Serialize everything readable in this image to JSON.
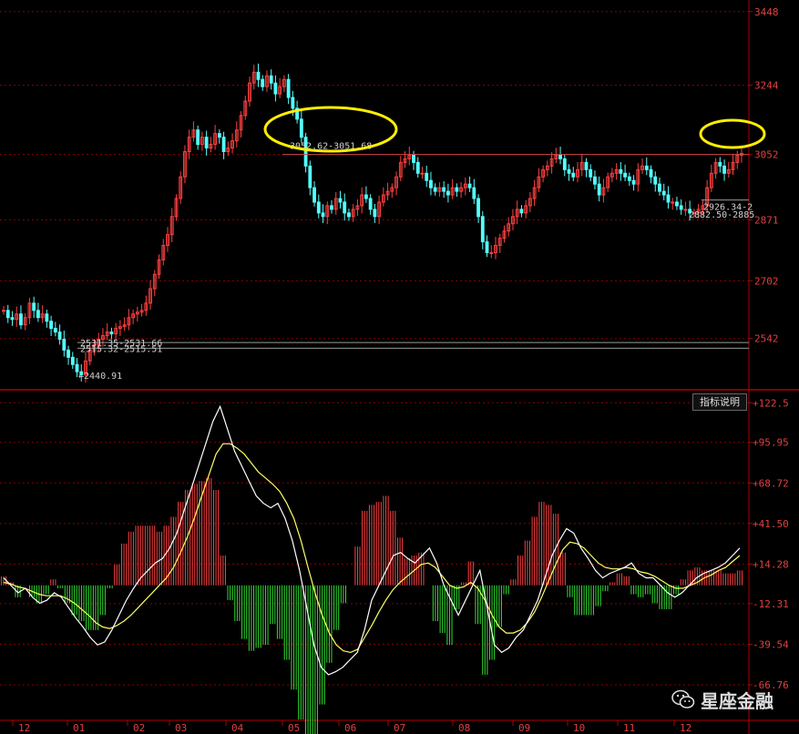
{
  "indicator_button_label": "指标说明",
  "watermark_text": "星座金融",
  "colors": {
    "up": "#ff4040",
    "down": "#54ffff",
    "macd_pos": "#ff4040",
    "macd_neg": "#33dd33",
    "dif": "#ffffff",
    "dea": "#ffff66",
    "grid": "#8b0000",
    "highlight": "#ffee00"
  },
  "chart_data": [
    {
      "type": "candlestick",
      "title": "",
      "y_ticks": [
        "3448",
        "3244",
        "3052",
        "2871",
        "2702",
        "2542"
      ],
      "ylim": [
        2400,
        3460
      ],
      "x_ticks": [
        "12",
        "01",
        "02",
        "03",
        "04",
        "05",
        "06",
        "07",
        "08",
        "09",
        "10",
        "11",
        "12"
      ],
      "close_series": [
        2620,
        2600,
        2595,
        2610,
        2580,
        2600,
        2640,
        2620,
        2600,
        2610,
        2590,
        2570,
        2560,
        2540,
        2510,
        2490,
        2470,
        2450,
        2441,
        2480,
        2510,
        2525,
        2540,
        2550,
        2560,
        2555,
        2570,
        2575,
        2580,
        2600,
        2610,
        2615,
        2620,
        2640,
        2680,
        2720,
        2760,
        2800,
        2830,
        2880,
        2930,
        2990,
        3060,
        3100,
        3120,
        3080,
        3100,
        3070,
        3080,
        3110,
        3100,
        3060,
        3070,
        3090,
        3120,
        3160,
        3200,
        3250,
        3280,
        3260,
        3240,
        3270,
        3250,
        3220,
        3240,
        3260,
        3210,
        3180,
        3150,
        3100,
        3020,
        2960,
        2920,
        2890,
        2880,
        2910,
        2900,
        2930,
        2920,
        2890,
        2880,
        2900,
        2910,
        2940,
        2930,
        2900,
        2880,
        2920,
        2940,
        2950,
        2960,
        2990,
        3030,
        3040,
        3050,
        3030,
        3000,
        3000,
        2980,
        2960,
        2950,
        2960,
        2950,
        2940,
        2960,
        2950,
        2960,
        2970,
        2960,
        2930,
        2880,
        2810,
        2780,
        2780,
        2800,
        2820,
        2840,
        2860,
        2880,
        2900,
        2890,
        2910,
        2930,
        2960,
        2990,
        3010,
        3020,
        3040,
        3050,
        3040,
        3010,
        3000,
        2990,
        3010,
        3030,
        3010,
        2990,
        2970,
        2940,
        2960,
        2990,
        3000,
        3010,
        3000,
        2990,
        2980,
        2970,
        3010,
        3020,
        3010,
        2990,
        2970,
        2950,
        2940,
        2920,
        2920,
        2910,
        2900,
        2900,
        2890,
        2890,
        2900,
        2910,
        2960,
        3000,
        3030,
        3020,
        3000,
        3010,
        3030,
        3050,
        3055
      ],
      "price_annotations": [
        {
          "label": "3052.62-3051.68"
        },
        {
          "label": "2531.35-2531.66"
        },
        {
          "label": "2515.32-2515.51"
        },
        {
          "label": "2440.91"
        },
        {
          "label": "2926.34-2"
        },
        {
          "label": "2882.50-2885"
        }
      ],
      "highlighted_level": 3052
    },
    {
      "type": "macd",
      "title": "",
      "y_ticks": [
        "+122.5",
        "+95.95",
        "+68.72",
        "+41.50",
        "+14.28",
        "-12.31",
        "-39.54",
        "-66.76"
      ],
      "ylim": [
        -90,
        130
      ],
      "dif": [
        5,
        0,
        -5,
        -2,
        -8,
        -12,
        -10,
        -5,
        -8,
        -15,
        -22,
        -28,
        -35,
        -40,
        -38,
        -30,
        -20,
        -10,
        -2,
        5,
        10,
        15,
        18,
        25,
        35,
        50,
        65,
        80,
        95,
        110,
        120,
        105,
        90,
        80,
        70,
        60,
        55,
        52,
        55,
        45,
        30,
        10,
        -15,
        -40,
        -55,
        -60,
        -58,
        -55,
        -50,
        -45,
        -30,
        -10,
        0,
        10,
        20,
        22,
        18,
        15,
        20,
        25,
        15,
        0,
        -10,
        -20,
        -10,
        0,
        10,
        -15,
        -40,
        -45,
        -42,
        -35,
        -30,
        -20,
        -10,
        5,
        20,
        30,
        38,
        35,
        25,
        18,
        10,
        5,
        8,
        10,
        12,
        15,
        8,
        5,
        5,
        0,
        -5,
        -8,
        -5,
        0,
        5,
        8,
        10,
        12,
        15,
        20,
        25
      ],
      "dea": [
        2,
        1,
        -1,
        -2,
        -4,
        -6,
        -7,
        -7,
        -7,
        -9,
        -12,
        -16,
        -20,
        -25,
        -28,
        -29,
        -27,
        -24,
        -20,
        -15,
        -10,
        -5,
        0,
        5,
        12,
        22,
        33,
        46,
        60,
        74,
        88,
        95,
        95,
        92,
        88,
        82,
        76,
        72,
        68,
        63,
        55,
        45,
        30,
        12,
        -5,
        -20,
        -32,
        -40,
        -44,
        -45,
        -43,
        -35,
        -27,
        -18,
        -10,
        -3,
        2,
        6,
        10,
        14,
        15,
        12,
        6,
        0,
        -2,
        -1,
        2,
        -2,
        -10,
        -20,
        -28,
        -32,
        -32,
        -30,
        -25,
        -18,
        -8,
        3,
        14,
        24,
        29,
        28,
        25,
        20,
        15,
        12,
        11,
        11,
        12,
        11,
        9,
        8,
        6,
        3,
        0,
        -2,
        -2,
        0,
        2,
        5,
        7,
        10,
        12,
        16,
        20
      ],
      "hist": [
        6,
        2,
        -8,
        0,
        -8,
        -12,
        -6,
        4,
        -2,
        -12,
        -20,
        -24,
        -30,
        -30,
        -20,
        -2,
        14,
        28,
        36,
        40,
        40,
        40,
        36,
        40,
        46,
        56,
        64,
        68,
        70,
        72,
        64,
        20,
        -10,
        -24,
        -36,
        -44,
        -42,
        -40,
        -26,
        -36,
        -50,
        -70,
        -90,
        -104,
        -100,
        -80,
        -52,
        -30,
        -12,
        0,
        26,
        50,
        54,
        56,
        60,
        50,
        32,
        18,
        20,
        22,
        0,
        -24,
        -32,
        -40,
        -16,
        2,
        16,
        -26,
        -60,
        -50,
        -28,
        -6,
        4,
        20,
        30,
        46,
        56,
        54,
        48,
        22,
        -8,
        -20,
        -20,
        -20,
        -14,
        -4,
        2,
        8,
        6,
        -6,
        -8,
        -6,
        -12,
        -16,
        -16,
        -6,
        4,
        10,
        12,
        10,
        10,
        10,
        8,
        8,
        10
      ]
    }
  ]
}
